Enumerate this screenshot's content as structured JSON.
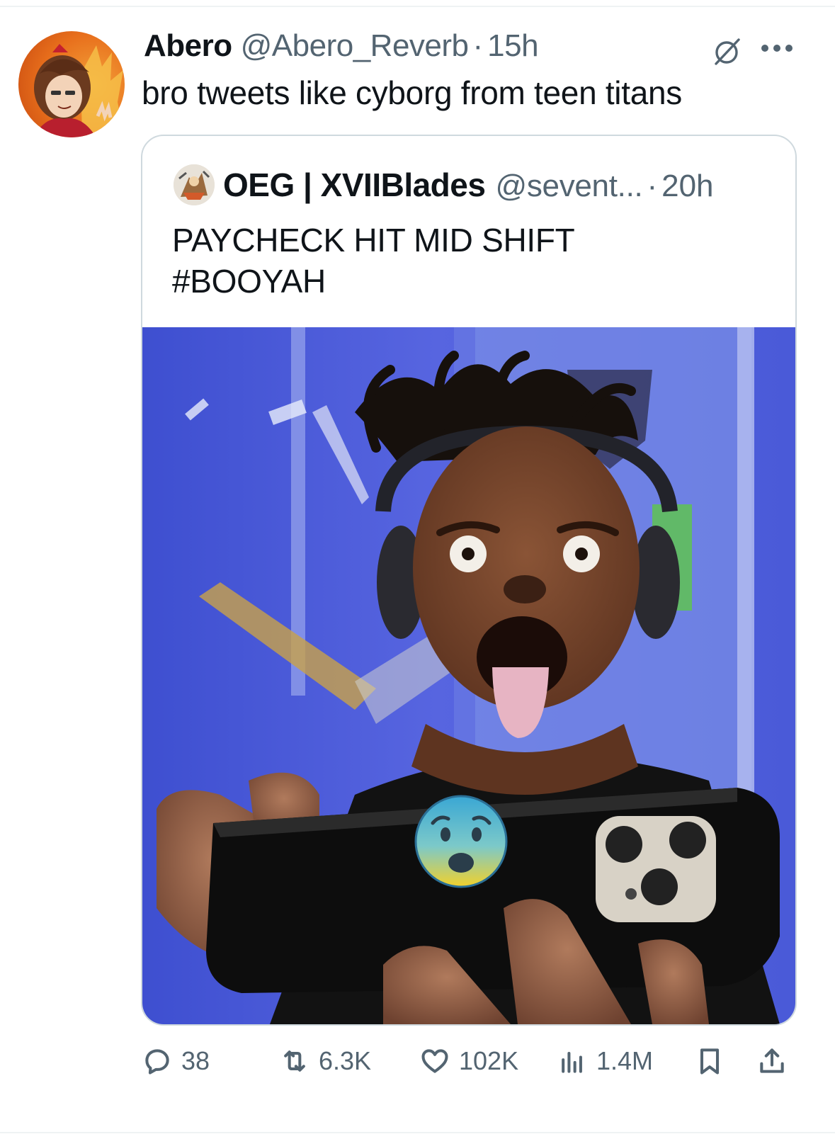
{
  "tweet": {
    "display_name": "Abero",
    "handle": "@Abero_Reverb",
    "separator": "·",
    "time": "15h",
    "text": "bro tweets like cyborg from teen titans"
  },
  "quoted": {
    "display_name": "OEG | XVIIBlades",
    "handle": "@sevent...",
    "separator": "·",
    "time": "20h",
    "text_line1": "PAYCHECK HIT MID SHIFT",
    "text_line2": "#BOOYAH"
  },
  "actions": {
    "replies": "38",
    "reposts": "6.3K",
    "likes": "102K",
    "views": "1.4M"
  },
  "icons": [
    "grok-icon",
    "more-icon",
    "reply-icon",
    "repost-icon",
    "like-icon",
    "views-icon",
    "bookmark-icon",
    "share-icon",
    "fearful-emoji-icon"
  ],
  "colors": {
    "text": "#0f1419",
    "secondary": "#536471",
    "border": "#cfd9de"
  }
}
